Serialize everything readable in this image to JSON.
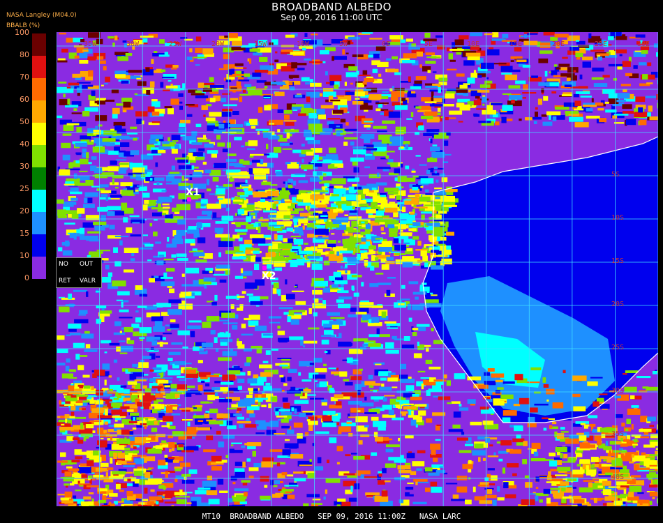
{
  "header": {
    "title": "BROADBAND ALBEDO",
    "subtitle": "Sep 09, 2016 11:00 UTC",
    "source": "NASA Langley (M04.0)",
    "units_label": "BBALB (%)"
  },
  "colorbar": {
    "ticks": [
      "100",
      "80",
      "70",
      "60",
      "50",
      "40",
      "30",
      "25",
      "20",
      "15",
      "10",
      "0"
    ],
    "segments": [
      {
        "label": "80-100",
        "color": "#6a0000"
      },
      {
        "label": "70-80",
        "color": "#e01010"
      },
      {
        "label": "60-70",
        "color": "#ff6a00"
      },
      {
        "label": "50-60",
        "color": "#ffa800"
      },
      {
        "label": "40-50",
        "color": "#ffff00"
      },
      {
        "label": "30-40",
        "color": "#80e000"
      },
      {
        "label": "25-30",
        "color": "#008000"
      },
      {
        "label": "20-25",
        "color": "#00ffff"
      },
      {
        "label": "15-20",
        "color": "#1e90ff"
      },
      {
        "label": "10-15",
        "color": "#0000ee"
      },
      {
        "label": "0-10",
        "color": "#8a2be2"
      }
    ]
  },
  "legend": {
    "no": "NO",
    "out": "OUT",
    "ret": "RET",
    "valr": "VALR"
  },
  "markers": [
    {
      "label": "X1"
    },
    {
      "label": "X2"
    }
  ],
  "grid_labels": {
    "longitudes": [
      "35W",
      "30W",
      "25W",
      "20W",
      "15W",
      "10W",
      "5W",
      "0E",
      "5E",
      "10E",
      "15E",
      "20E",
      "25E",
      "30E",
      "35E"
    ],
    "latitudes": [
      "5S",
      "10S",
      "15S",
      "20S",
      "25S",
      "30S",
      "35S",
      "40S"
    ]
  },
  "footer": "MT10  BROADBAND ALBEDO   SEP 09, 2016 11:00Z   NASA LARC"
}
